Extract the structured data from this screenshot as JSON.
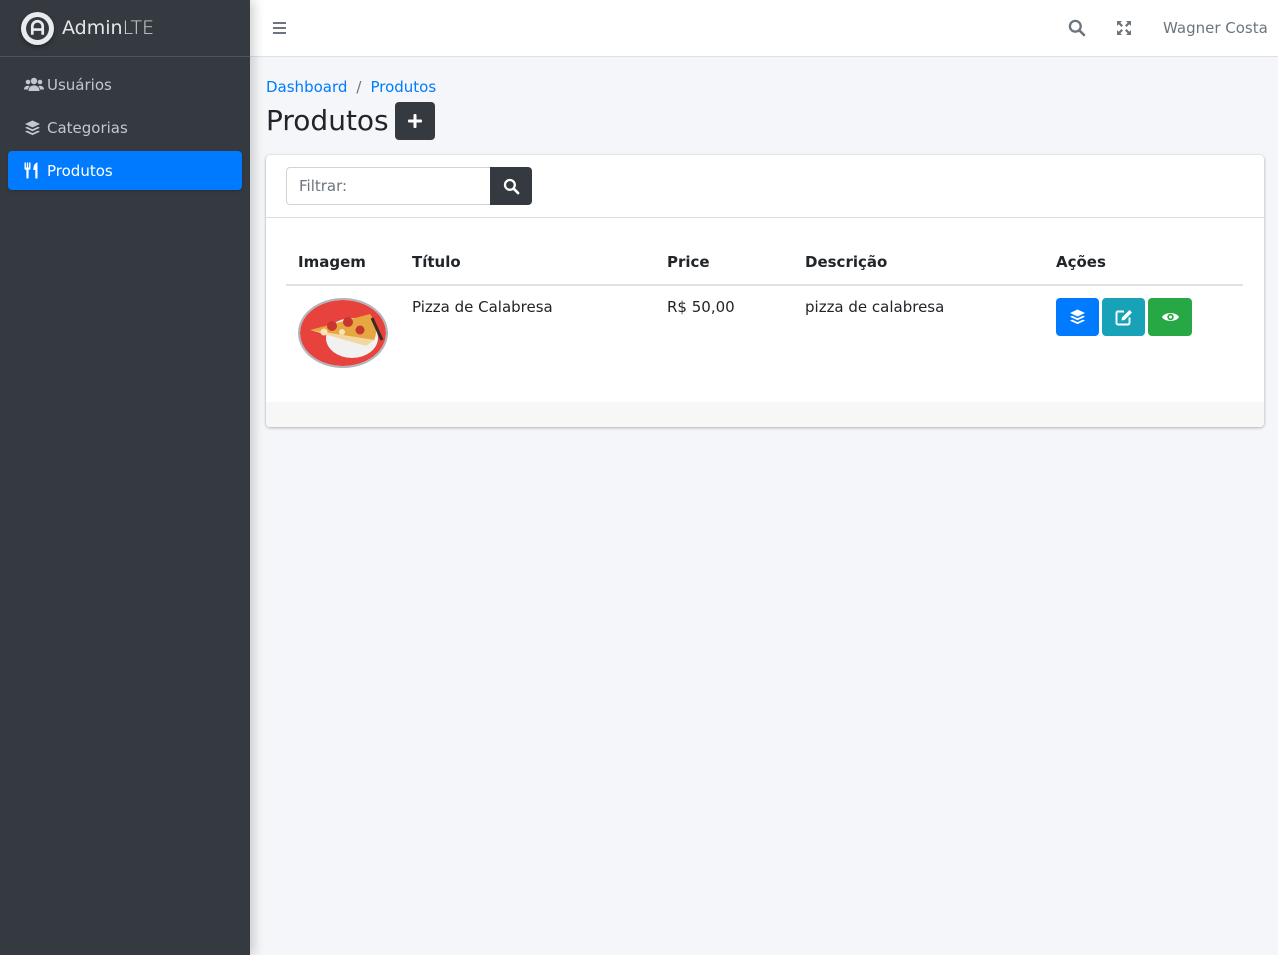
{
  "brand": {
    "name_bold": "Admin",
    "name_light": "LTE"
  },
  "sidebar": {
    "items": [
      {
        "label": "Usuários",
        "icon": "users-icon"
      },
      {
        "label": "Categorias",
        "icon": "layers-icon"
      },
      {
        "label": "Produtos",
        "icon": "utensils-icon",
        "active": true
      }
    ]
  },
  "navbar": {
    "user_name": "Wagner Costa"
  },
  "breadcrumb": {
    "items": [
      "Dashboard",
      "Produtos"
    ],
    "separator": "/"
  },
  "page": {
    "title": "Produtos"
  },
  "filter": {
    "placeholder": "Filtrar:",
    "value": ""
  },
  "table": {
    "headers": [
      "Imagem",
      "Título",
      "Price",
      "Descrição",
      "Ações"
    ],
    "rows": [
      {
        "image": "pizza-photo",
        "title": "Pizza de Calabresa",
        "price": "R$ 50,00",
        "description": "pizza de calabresa"
      }
    ]
  },
  "colors": {
    "primary": "#007bff",
    "info": "#17a2b8",
    "success": "#28a745",
    "dark": "#343a40",
    "sidebar_bg": "#343a40"
  }
}
